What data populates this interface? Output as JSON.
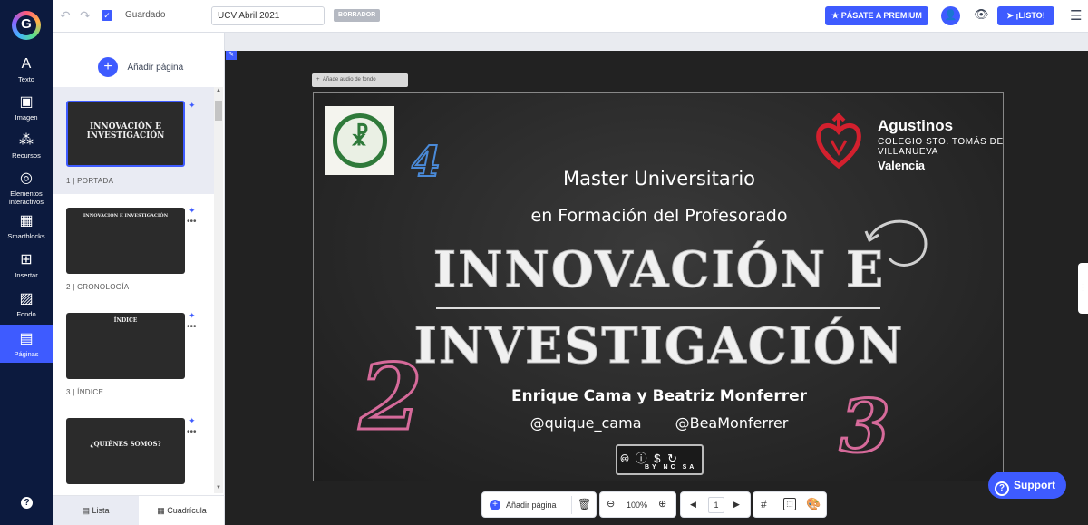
{
  "app": {
    "logo_letter": "G"
  },
  "rail": {
    "items": [
      {
        "label": "Texto",
        "icon": "A"
      },
      {
        "label": "Imagen",
        "icon": "▣"
      },
      {
        "label": "Recursos",
        "icon": "⁂"
      },
      {
        "label": "Elementos interactivos",
        "icon": "◎"
      },
      {
        "label": "Smartblocks",
        "icon": "▦"
      },
      {
        "label": "Insertar",
        "icon": "⊞"
      },
      {
        "label": "Fondo",
        "icon": "▨"
      },
      {
        "label": "Páginas",
        "icon": "▤"
      }
    ],
    "help_icon": "?"
  },
  "topbar": {
    "undo_icon": "↶",
    "redo_icon": "↷",
    "saved_label": "Guardado",
    "title_value": "UCV Abril 2021",
    "draft_badge": "BORRADOR",
    "premium_label": "★ PÁSATE A PREMIUM",
    "avatar_icon": "👤",
    "preview_icon": "👁",
    "ready_label": "➤ ¡LISTO!",
    "menu_icon": "☰"
  },
  "panel": {
    "add_page_label": "Añadir página",
    "add_icon": "+",
    "pages": [
      {
        "label": "1 |  PORTADA",
        "thumb_text": "INNOVACIÓN E INVESTIGACIÓN"
      },
      {
        "label": "2 |  CRONOLOGÍA",
        "thumb_text": "INNOVACIÓN E INVESTIGACIÓN"
      },
      {
        "label": "3 |  ÍNDICE",
        "thumb_text": "ÍNDICE"
      },
      {
        "label": "",
        "thumb_text": "¿QUIÉNES SOMOS?"
      }
    ],
    "tab_list": "Lista",
    "tab_grid": "Cuadrícula"
  },
  "canvas": {
    "audio_label": "Añade audio de fondo",
    "slide": {
      "logo_mark": "☧",
      "school_name": "Agustinos",
      "school_sub": "COLEGIO STO. TOMÁS DE VILLANUEVA",
      "school_city": "Valencia",
      "line1": "Master Universitario",
      "line2": "en Formación del Profesorado",
      "title1": "INNOVACIÓN E",
      "title2": "INVESTIGACIÓN",
      "authors": "Enrique Cama  y  Beatriz Monferrer",
      "handle1": "@quique_cama",
      "handle2": "@BeaMonferrer",
      "cc_icons": "🅭 ⓘ $ ↻",
      "cc_terms": "BY NC SA",
      "num_a": "4",
      "num_b": "2",
      "num_c": "3"
    }
  },
  "bottombar": {
    "add_page_label": "Añadir página",
    "zoom_value": "100%",
    "page_number": "1",
    "prev_icon": "◀",
    "next_icon": "▶"
  },
  "support_label": "Support",
  "colors": {
    "accent": "#3e5bff",
    "rail": "#0c1a3e"
  }
}
